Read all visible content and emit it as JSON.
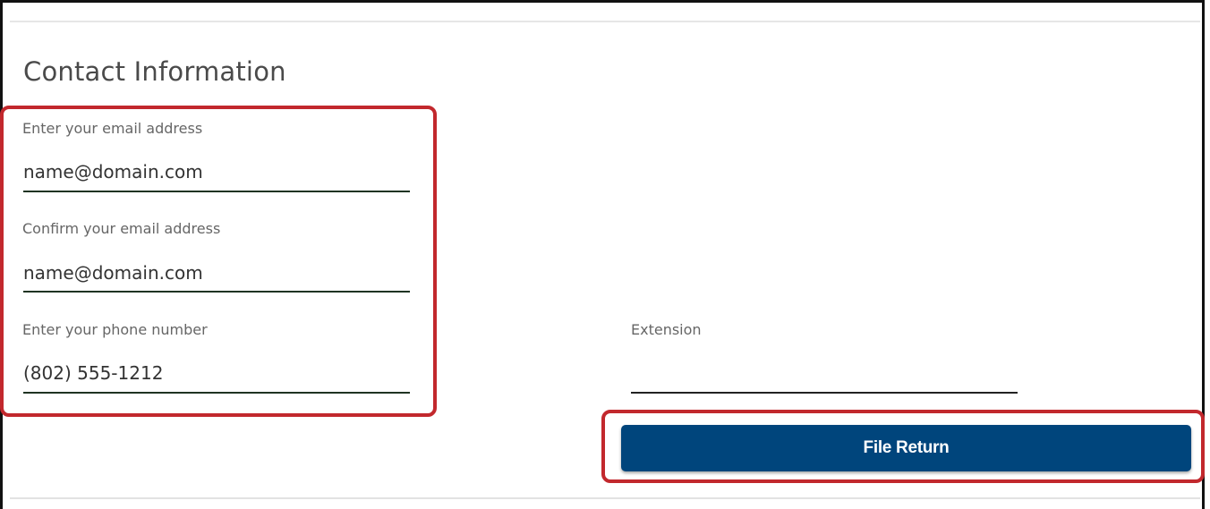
{
  "section": {
    "title": "Contact Information"
  },
  "form": {
    "email": {
      "label": "Enter your email address",
      "value": "name@domain.com"
    },
    "confirm_email": {
      "label": "Confirm your email address",
      "value": "name@domain.com"
    },
    "phone": {
      "label": "Enter your phone number",
      "value": "(802) 555-1212"
    },
    "extension": {
      "label": "Extension",
      "value": ""
    }
  },
  "actions": {
    "file_return_label": "File Return"
  },
  "colors": {
    "highlight": "#c2282d",
    "button": "#00457c"
  }
}
